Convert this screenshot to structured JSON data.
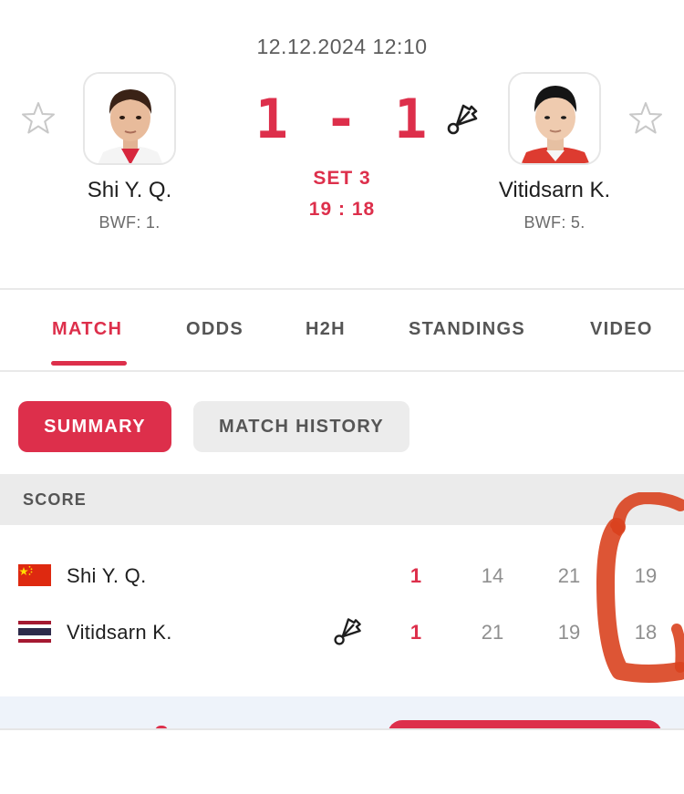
{
  "match": {
    "datetime": "12.12.2024 12:10",
    "score": "1 - 1",
    "set_label": "SET 3",
    "set_score": "19 : 18"
  },
  "home": {
    "name": "Shi Y. Q.",
    "rank": "BWF: 1."
  },
  "away": {
    "name": "Vitidsarn K.",
    "rank": "BWF: 5."
  },
  "tabs": [
    {
      "label": "MATCH",
      "active": true
    },
    {
      "label": "ODDS"
    },
    {
      "label": "H2H"
    },
    {
      "label": "STANDINGS"
    },
    {
      "label": "VIDEO"
    }
  ],
  "subtabs": {
    "summary": "SUMMARY",
    "history": "MATCH HISTORY"
  },
  "score_table": {
    "header": "SCORE",
    "rows": [
      {
        "name": "Shi Y. Q.",
        "flag": "china-flag",
        "sets": "1",
        "games": [
          "14",
          "21",
          "19"
        ]
      },
      {
        "name": "Vitidsarn K.",
        "flag": "thailand-flag",
        "sets": "1",
        "games": [
          "21",
          "19",
          "18"
        ],
        "serving": true
      }
    ]
  },
  "colors": {
    "accent": "#dd2f4b",
    "muted": "#8f8f8f",
    "header_bg": "#ebebeb",
    "scribble": "#d9421f"
  },
  "icons": [
    "star-icon",
    "shuttlecock-icon"
  ]
}
